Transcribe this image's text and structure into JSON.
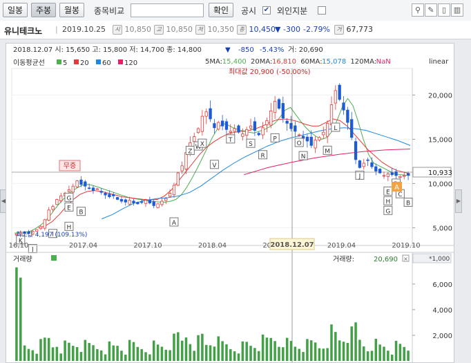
{
  "toolbar": {
    "daily_btn": "일봉",
    "weekly_btn": "주봉",
    "monthly_btn": "월봉",
    "compare_label": "종목비교",
    "compare_value": "",
    "confirm_btn": "확인",
    "disclosure_label": "공시",
    "disclosure_checked": true,
    "foreign_label": "외인지분",
    "foreign_checked": false
  },
  "stock": {
    "name": "유니테크노",
    "date": "2019.10.25",
    "open_icon": "시",
    "open": "10,850",
    "high_icon": "고",
    "high": "10,850",
    "low_icon": "저",
    "low": "10,350",
    "close_icon": "종",
    "close": "10,450",
    "change_arrow": "▼",
    "change": "-300",
    "change_pct": "-2.79%",
    "volume_icon": "거",
    "volume": "67,773"
  },
  "chart": {
    "cursor_info": "2018.12.07 시: 15,650 고: 15,800 저: 14,700 종: 14,800",
    "cursor_change_arrow": "▼",
    "cursor_change": "-850",
    "cursor_change_pct": "-5.43%",
    "cursor_volume": "거: 20,690",
    "ma_title": "이동평균선",
    "ma_legend": [
      {
        "label": "5",
        "color": "#4caf50"
      },
      {
        "label": "20",
        "color": "#e53935"
      },
      {
        "label": "60",
        "color": "#1e88e5"
      },
      {
        "label": "120",
        "color": "#e91e63"
      }
    ],
    "ma_values": [
      {
        "label": "5MA:",
        "value": "15,400",
        "color": "#4caf50"
      },
      {
        "label": "20MA:",
        "value": "16,810",
        "color": "#e53935"
      },
      {
        "label": "60MA:",
        "value": "15,078",
        "color": "#1e88e5"
      },
      {
        "label": "120MA:",
        "value": "NaN",
        "color": "#e91e63"
      }
    ],
    "scale_type": "linear",
    "max_annotation": "최대값 20,900 (-50.00%)",
    "min_annotation": "최소값 4,197 (109.13%)",
    "badge": "무증",
    "current_price": "10,933",
    "current_marker": "A",
    "cursor_date": "2018.12.07",
    "volume_title": "거래량",
    "volume_readout_label": "거래량:",
    "volume_readout": "20,690",
    "volume_multiplier": "*1,000",
    "price_axis_ticks": [
      {
        "label": "20,000",
        "value": 20000
      },
      {
        "label": "15,000",
        "value": 15000
      },
      {
        "label": "10,000",
        "value": 10000
      },
      {
        "label": "5,000",
        "value": 5000
      }
    ],
    "volume_axis_ticks": [
      {
        "label": "6,000",
        "value": 6000
      },
      {
        "label": "4,000",
        "value": 4000
      },
      {
        "label": "2,000",
        "value": 2000
      }
    ],
    "date_ticks": [
      "16.10",
      "2017.04",
      "2017.10",
      "2018.04",
      "2018.10",
      "2019.04",
      "2019.10"
    ],
    "event_letters": [
      "K",
      "J",
      "I",
      "H",
      "G",
      "E",
      "B",
      "A",
      "Z",
      "W",
      "X",
      "V",
      "T",
      "S",
      "R",
      "P",
      "O",
      "N",
      "M",
      "L",
      "J",
      "E",
      "H",
      "G",
      "D",
      "C",
      "B"
    ]
  },
  "chart_data": {
    "type": "candlestick",
    "title": "유니테크노 주봉",
    "frequency": "weekly",
    "x_start": "2016-10",
    "x_end": "2019-10",
    "ylim": [
      3000,
      23000
    ],
    "ohlc_close": [
      4300,
      4500,
      4400,
      4350,
      4600,
      4800,
      5100,
      5900,
      7000,
      7400,
      8200,
      8600,
      8900,
      9300,
      9700,
      10300,
      9900,
      9700,
      9500,
      9200,
      9400,
      9000,
      8700,
      8500,
      8600,
      8200,
      8000,
      7900,
      8100,
      7800,
      7700,
      7900,
      8100,
      7800,
      7500,
      7700,
      8000,
      8300,
      8900,
      9800,
      11200,
      12000,
      13500,
      14600,
      15300,
      16200,
      17600,
      18100,
      17300,
      16300,
      16900,
      16500,
      16100,
      15900,
      16200,
      15800,
      15600,
      16100,
      16500,
      16000,
      15500,
      16300,
      17100,
      18200,
      19300,
      18500,
      17400,
      16800,
      16200,
      15900,
      15500,
      15100,
      14800,
      14300,
      14900,
      15200,
      15800,
      16800,
      18900,
      20500,
      19500,
      18300,
      16900,
      15200,
      12700,
      11800,
      12300,
      12600,
      11900,
      11400,
      11200,
      10900,
      11100,
      11000,
      10900,
      10800,
      10900,
      10933
    ],
    "ma": {
      "5": [
        4400,
        4450,
        4500,
        4600,
        4900,
        5300,
        5800,
        6500,
        7300,
        8000,
        8600,
        9100,
        9500,
        9800,
        9900,
        9800,
        9600,
        9400,
        9200,
        9000,
        8800,
        8600,
        8400,
        8300,
        8200,
        8100,
        8000,
        7950,
        7900,
        7900,
        8000,
        8200,
        8700,
        9500,
        10500,
        11600,
        12800,
        14000,
        15200,
        16200,
        16800,
        16600,
        16300,
        16100,
        15900,
        15800,
        15700,
        15900,
        16100,
        16400,
        16800,
        17500,
        18300,
        18600,
        17800,
        17000,
        16300,
        15700,
        15300,
        15000,
        15200,
        15900,
        17200,
        18700,
        19600,
        18800,
        17000,
        15000,
        13300,
        12300,
        12000,
        11700,
        11400,
        11100,
        11000,
        10950,
        10900
      ],
      "20": [
        5000,
        5200,
        5700,
        6500,
        7400,
        8200,
        8800,
        9100,
        9200,
        9100,
        8900,
        8700,
        8500,
        8400,
        8300,
        8200,
        8150,
        8200,
        8600,
        9300,
        10300,
        11300,
        12300,
        13300,
        14100,
        14700,
        15200,
        15600,
        15800,
        15900,
        16000,
        16200,
        16500,
        16900,
        17200,
        17300,
        17200,
        17000,
        16700,
        16500,
        16500,
        16900,
        17300,
        17100,
        16500,
        15600,
        14700,
        13800,
        13100,
        12400,
        11900,
        11500,
        11300,
        11100
      ],
      "60": [
        6000,
        6500,
        7200,
        7800,
        8100,
        8300,
        8400,
        8600,
        9000,
        9700,
        10600,
        11500,
        12300,
        13000,
        13600,
        14200,
        14700,
        15100,
        15400,
        15700,
        16000,
        16200,
        16300,
        16200,
        16000,
        15600,
        15200,
        14800,
        14300
      ],
      "120": [
        11000,
        11800,
        12400,
        12900,
        13300,
        13600,
        13800,
        13900
      ]
    },
    "max": 20900,
    "min": 4197,
    "volume_unit": "*1,000",
    "volume_ylim": [
      0,
      7500
    ]
  }
}
